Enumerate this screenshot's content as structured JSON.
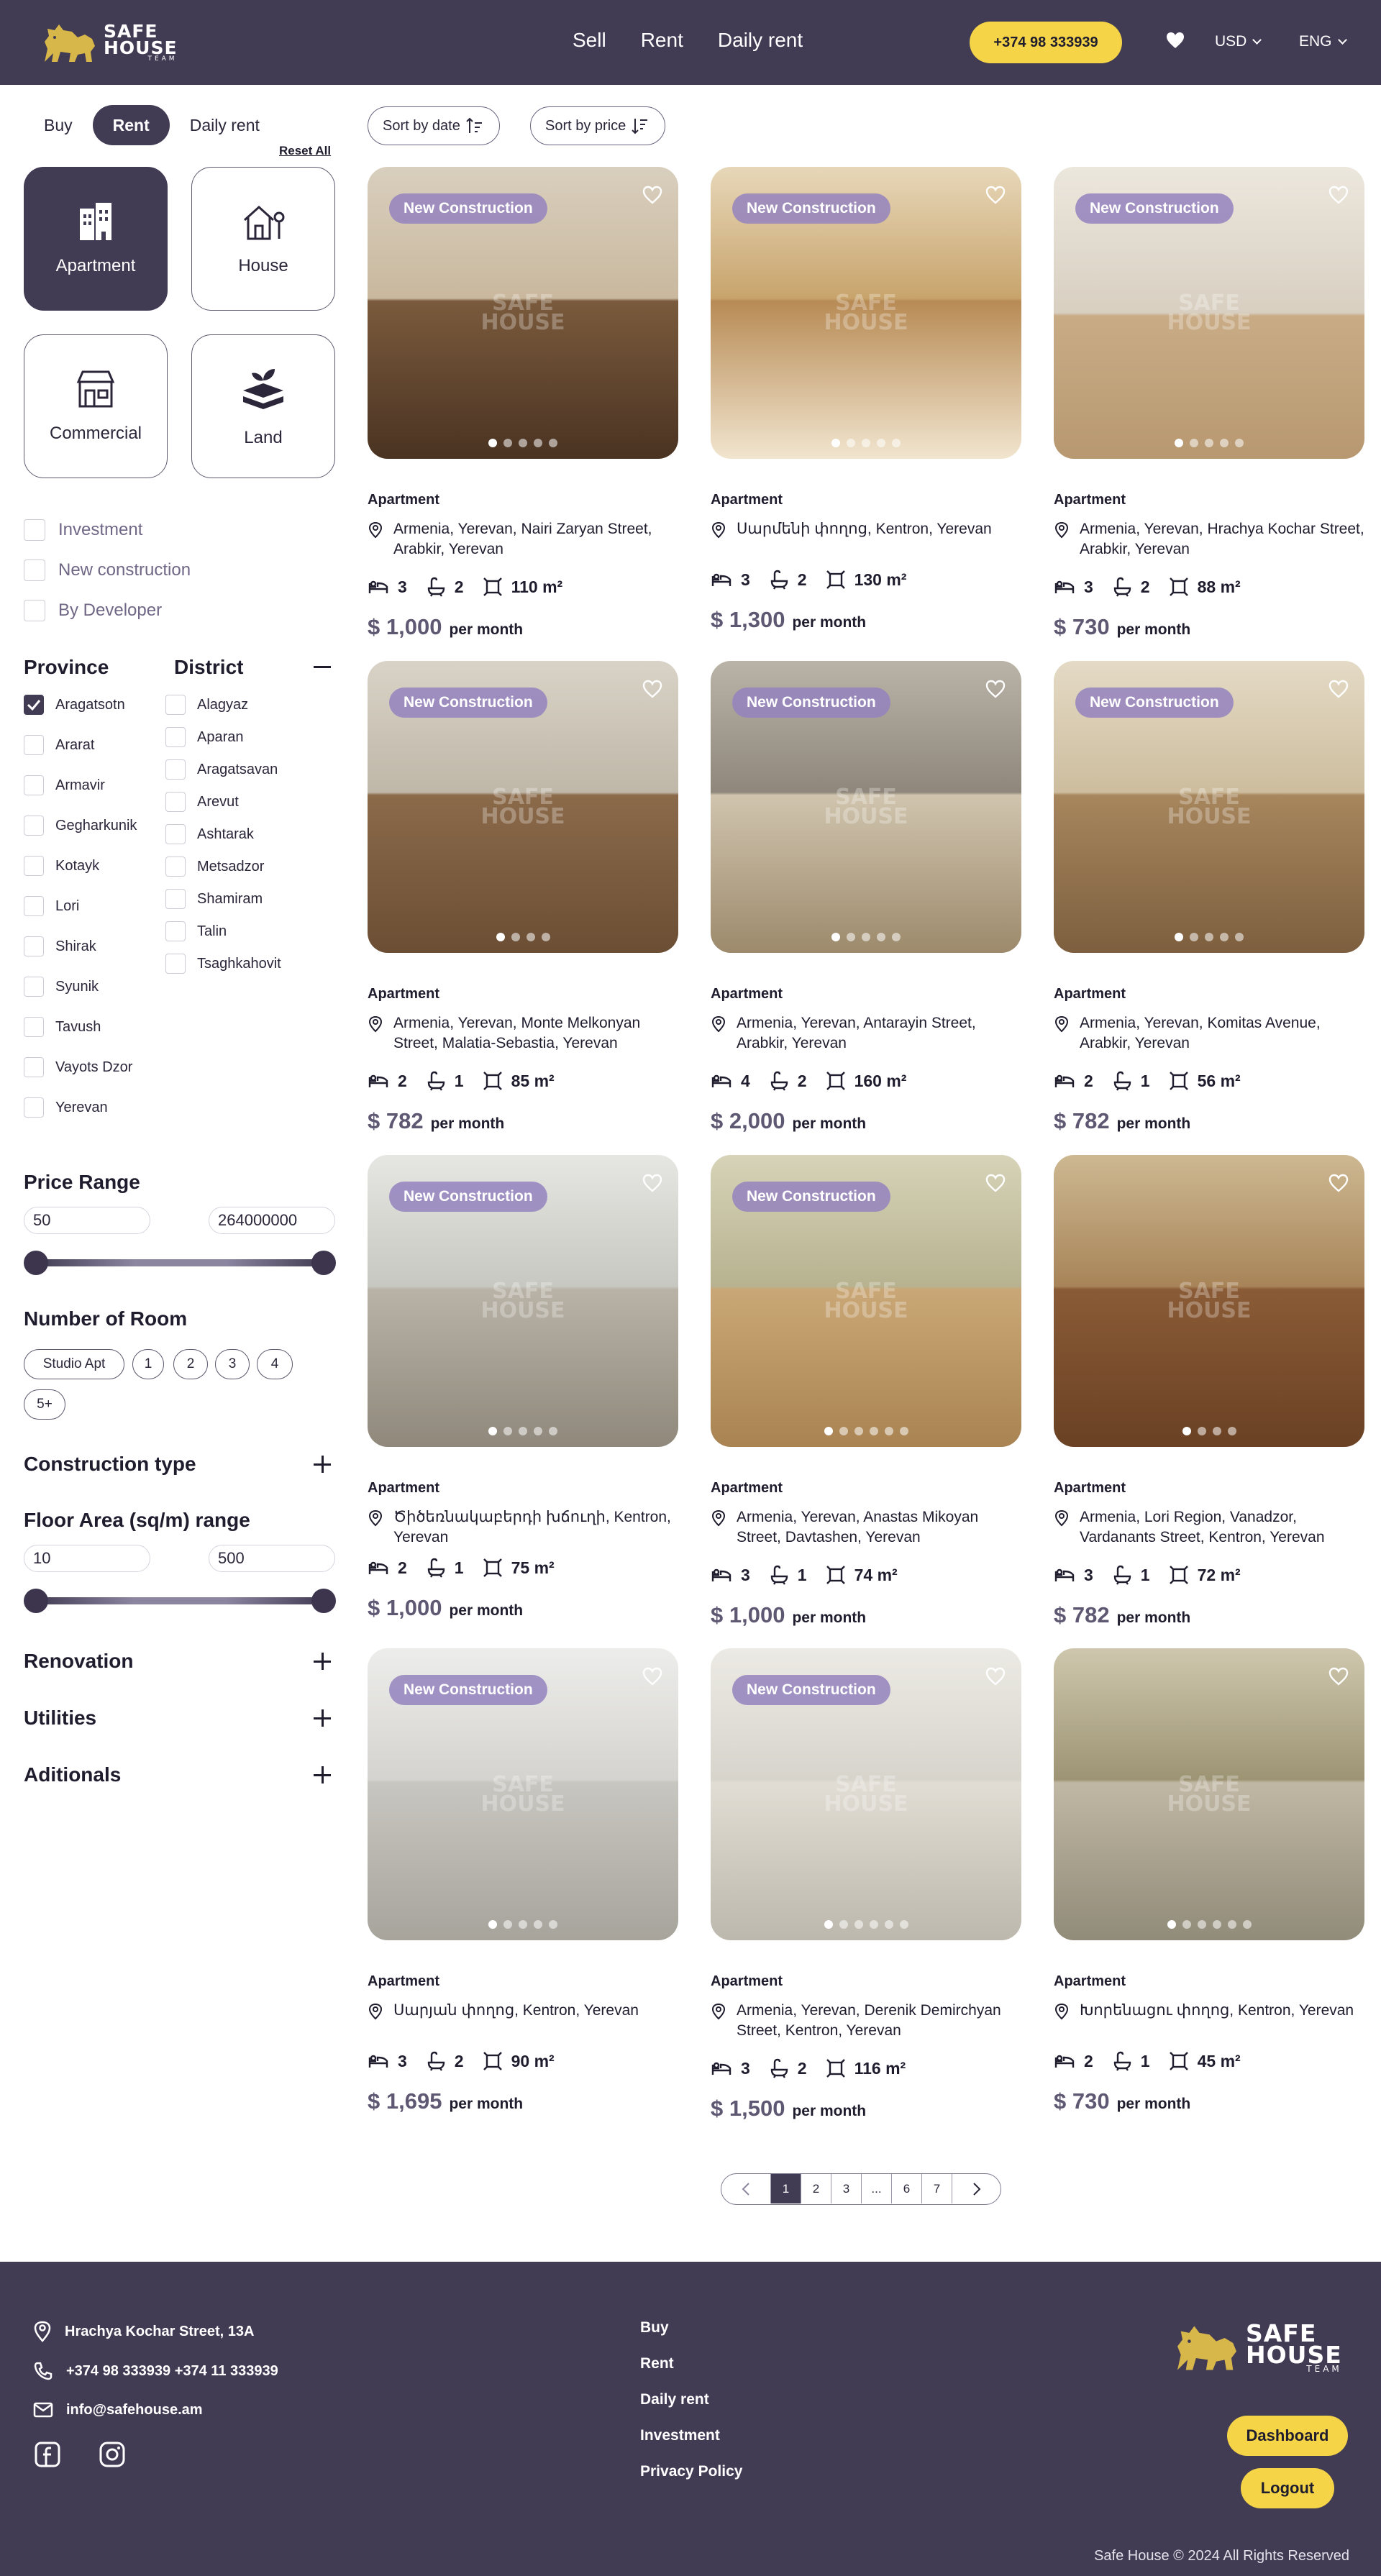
{
  "header": {
    "logo": {
      "line1": "SAFE",
      "line2": "HOUSE",
      "line3": "TEAM"
    },
    "nav": [
      "Sell",
      "Rent",
      "Daily rent"
    ],
    "phone": "+374 98 333939",
    "currency": "USD",
    "language": "ENG"
  },
  "filters": {
    "tabs": [
      "Buy",
      "Rent",
      "Daily rent"
    ],
    "active_tab": "Rent",
    "reset": "Reset All",
    "sort_date": "Sort by date",
    "sort_price": "Sort by price",
    "property_types": [
      "Apartment",
      "House",
      "Commercial",
      "Land"
    ],
    "options": [
      "Investment",
      "New construction",
      "By Developer"
    ],
    "province_title": "Province",
    "district_title": "District",
    "provinces": [
      "Aragatsotn",
      "Ararat",
      "Armavir",
      "Gegharkunik",
      "Kotayk",
      "Lori",
      "Shirak",
      "Syunik",
      "Tavush",
      "Vayots Dzor",
      "Yerevan"
    ],
    "checked_province": "Aragatsotn",
    "districts": [
      "Alagyaz",
      "Aparan",
      "Aragatsavan",
      "Arevut",
      "Ashtarak",
      "Metsadzor",
      "Shamiram",
      "Talin",
      "Tsaghkahovit"
    ],
    "price_range_title": "Price Range",
    "price_min": "50",
    "price_max": "264000000",
    "rooms_title": "Number of Room",
    "rooms": [
      "Studio Apt",
      "1",
      "2",
      "3",
      "4",
      "5+"
    ],
    "construction_title": "Construction type",
    "floor_title": "Floor Area (sq/m) range",
    "floor_min": "10",
    "floor_max": "500",
    "renovation_title": "Renovation",
    "utilities_title": "Utilities",
    "additionals_title": "Aditionals"
  },
  "listings": [
    {
      "badge": "New Construction",
      "type": "Apartment",
      "address": "Armenia, Yerevan, Nairi Zaryan Street, Arabkir, Yerevan",
      "beds": "3",
      "baths": "2",
      "area": "110 m²",
      "price": "$ 1,000",
      "per": "per month"
    },
    {
      "badge": "New Construction",
      "type": "Apartment",
      "address": "Սարմենի փողոց, Kentron, Yerevan",
      "beds": "3",
      "baths": "2",
      "area": "130 m²",
      "price": "$ 1,300",
      "per": "per month"
    },
    {
      "badge": "New Construction",
      "type": "Apartment",
      "address": "Armenia, Yerevan, Hrachya Kochar Street, Arabkir, Yerevan",
      "beds": "3",
      "baths": "2",
      "area": "88 m²",
      "price": "$ 730",
      "per": "per month"
    },
    {
      "badge": "New Construction",
      "type": "Apartment",
      "address": "Armenia, Yerevan, Monte Melkonyan Street, Malatia-Sebastia, Yerevan",
      "beds": "2",
      "baths": "1",
      "area": "85 m²",
      "price": "$ 782",
      "per": "per month"
    },
    {
      "badge": "New Construction",
      "type": "Apartment",
      "address": "Armenia, Yerevan, Antarayin Street, Arabkir, Yerevan",
      "beds": "4",
      "baths": "2",
      "area": "160 m²",
      "price": "$ 2,000",
      "per": "per month"
    },
    {
      "badge": "New Construction",
      "type": "Apartment",
      "address": "Armenia, Yerevan, Komitas Avenue, Arabkir, Yerevan",
      "beds": "2",
      "baths": "1",
      "area": "56 m²",
      "price": "$ 782",
      "per": "per month"
    },
    {
      "badge": "New Construction",
      "type": "Apartment",
      "address": "Ծիծեռնակաբերդի խճուղի, Kentron, Yerevan",
      "beds": "2",
      "baths": "1",
      "area": "75 m²",
      "price": "$ 1,000",
      "per": "per month"
    },
    {
      "badge": "New Construction",
      "type": "Apartment",
      "address": "Armenia, Yerevan, Anastas Mikoyan Street, Davtashen, Yerevan",
      "beds": "3",
      "baths": "1",
      "area": "74 m²",
      "price": "$ 1,000",
      "per": "per month"
    },
    {
      "badge": "",
      "type": "Apartment",
      "address": "Armenia, Lori Region, Vanadzor, Vardanants Street, Kentron, Yerevan",
      "beds": "3",
      "baths": "1",
      "area": "72 m²",
      "price": "$ 782",
      "per": "per month"
    },
    {
      "badge": "New Construction",
      "type": "Apartment",
      "address": "Սարյան փողոց, Kentron, Yerevan",
      "beds": "3",
      "baths": "2",
      "area": "90 m²",
      "price": "$ 1,695",
      "per": "per month"
    },
    {
      "badge": "New Construction",
      "type": "Apartment",
      "address": "Armenia, Yerevan, Derenik Demirchyan Street, Kentron, Yerevan",
      "beds": "3",
      "baths": "2",
      "area": "116 m²",
      "price": "$ 1,500",
      "per": "per month"
    },
    {
      "badge": "",
      "type": "Apartment",
      "address": "Խորենացու փողոց, Kentron, Yerevan",
      "beds": "2",
      "baths": "1",
      "area": "45 m²",
      "price": "$ 730",
      "per": "per month"
    }
  ],
  "pagination": {
    "pages": [
      "1",
      "2",
      "3",
      "...",
      "6",
      "7"
    ],
    "current": "1"
  },
  "footer": {
    "address": "Hrachya Kochar Street, 13A",
    "phones": "+374 98 333939  +374 11 333939",
    "email": "info@safehouse.am",
    "links": [
      "Buy",
      "Rent",
      "Daily rent",
      "Investment",
      "Privacy Policy"
    ],
    "dashboard": "Dashboard",
    "logout": "Logout",
    "copyright": "Safe House © 2024 All Rights Reserved"
  },
  "colors": {
    "brand_dark": "#423b54",
    "accent_yellow": "#f5d547",
    "price": "#5f5873"
  }
}
